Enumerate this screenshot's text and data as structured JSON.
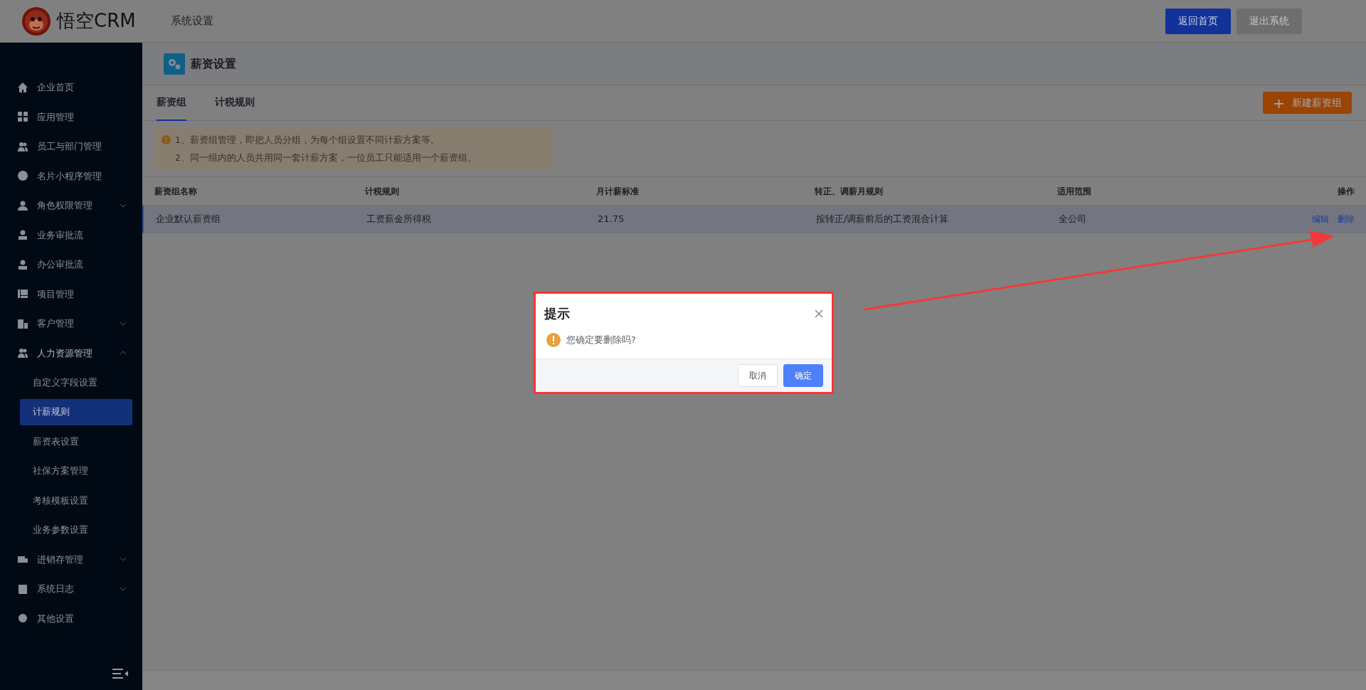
{
  "header": {
    "logo_text": "悟空CRM",
    "section_title": "系统设置",
    "buttons": [
      {
        "label": "返回首页",
        "kind": "primary"
      },
      {
        "label": "退出系统",
        "kind": "muted"
      }
    ]
  },
  "sidebar": {
    "items": [
      {
        "label": "企业首页"
      },
      {
        "label": "应用管理"
      },
      {
        "label": "员工与部门管理"
      },
      {
        "label": "名片小程序管理"
      },
      {
        "label": "角色权限管理",
        "expanded": false
      },
      {
        "label": "业务审批流"
      },
      {
        "label": "办公审批流"
      },
      {
        "label": "项目管理"
      },
      {
        "label": "客户管理",
        "expanded": false
      },
      {
        "label": "人力资源管理",
        "expanded": true,
        "children": [
          {
            "label": "自定义字段设置",
            "selected": false
          },
          {
            "label": "计薪规则",
            "selected": true
          },
          {
            "label": "薪资表设置",
            "selected": false
          },
          {
            "label": "社保方案管理",
            "selected": false
          },
          {
            "label": "考核模板设置",
            "selected": false
          },
          {
            "label": "业务参数设置",
            "selected": false
          }
        ]
      },
      {
        "label": "进销存管理",
        "expanded": false
      },
      {
        "label": "系统日志",
        "expanded": false
      },
      {
        "label": "其他设置"
      }
    ]
  },
  "page": {
    "title": "薪资设置",
    "tabs": [
      {
        "label": "薪资组",
        "selected": true
      },
      {
        "label": "计税规则",
        "selected": false
      }
    ],
    "new_button": {
      "icon_text": "+",
      "label": "新建薪资组"
    },
    "notice": [
      "1、薪资组管理，即把人员分组，为每个组设置不同计薪方案等。",
      "2、同一组内的人员共用同一套计薪方案，一位员工只能适用一个薪资组。"
    ],
    "table": {
      "columns": [
        "薪资组名称",
        "计税规则",
        "月计薪标准",
        "转正、调薪月规则",
        "适用范围",
        "操作"
      ],
      "rows": [
        {
          "selected": true,
          "cells": [
            "企业默认薪资组",
            "工资薪金所得税",
            "21.75",
            "按转正/调薪前后的工资混合计算",
            "全公司"
          ],
          "actions": [
            "编辑",
            "删除"
          ]
        }
      ]
    }
  },
  "dialog": {
    "title": "提示",
    "message": "您确定要删除吗?",
    "buttons": [
      {
        "label": "取消",
        "kind": "default"
      },
      {
        "label": "确定",
        "kind": "primary"
      }
    ]
  }
}
